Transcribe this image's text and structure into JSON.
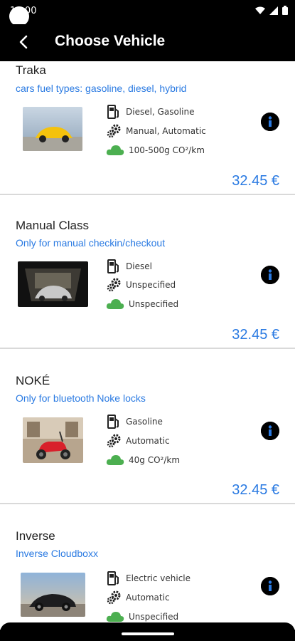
{
  "status": {
    "time": "10:00"
  },
  "app_bar": {
    "title": "Choose Vehicle"
  },
  "vehicles": [
    {
      "name": "Traka",
      "subtitle": "cars fuel types: gasoline, diesel, hybrid",
      "fuel": "Diesel, Gasoline",
      "transmission": "Manual, Automatic",
      "emissions": "100-500g CO²/km",
      "price": "32.45 €"
    },
    {
      "name": "Manual Class",
      "subtitle": "Only for manual checkin/checkout",
      "fuel": "Diesel",
      "transmission": "Unspecified",
      "emissions": "Unspecified",
      "price": "32.45 €"
    },
    {
      "name": "NOKÉ",
      "subtitle": "Only for bluetooth Noke locks",
      "fuel": "Gasoline",
      "transmission": "Automatic",
      "emissions": "40g CO²/km",
      "price": "32.45 €"
    },
    {
      "name": "Inverse",
      "subtitle": "Inverse Cloudboxx",
      "fuel": "Electric vehicle",
      "transmission": "Automatic",
      "emissions": "Unspecified",
      "price": ""
    }
  ],
  "icons": {
    "back": "arrow-left-icon",
    "fuel": "fuel-pump-icon",
    "transmission": "gears-icon",
    "emissions": "cloud-icon",
    "info": "info-icon"
  },
  "colors": {
    "accent": "#2a7ae2",
    "cloud": "#4caf50"
  }
}
